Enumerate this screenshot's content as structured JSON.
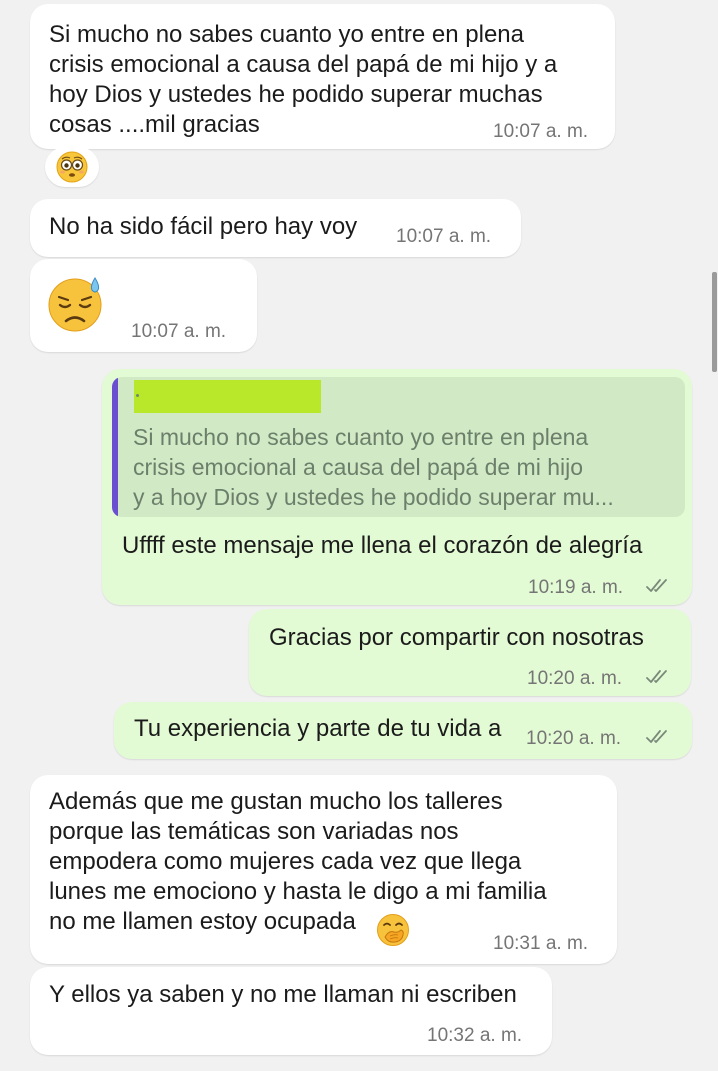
{
  "messages": [
    {
      "direction": "incoming",
      "lines": [
        "Si mucho no sabes cuanto yo entre en plena",
        "crisis emocional a causa del papá de mi hijo y a",
        "hoy Dios y ustedes he podido superar muchas",
        "cosas ....mil gracias"
      ],
      "time": "10:07 a. m."
    },
    {
      "direction": "incoming",
      "reaction_emoji": "flushed-face"
    },
    {
      "direction": "incoming",
      "text": "No ha sido fácil pero hay voy",
      "time": "10:07 a. m."
    },
    {
      "direction": "incoming",
      "emoji": "downcast-face-with-sweat",
      "time": "10:07 a. m."
    },
    {
      "direction": "outgoing",
      "quote": {
        "author": "",
        "lines": [
          "Si mucho no sabes cuanto yo entre en plena",
          "crisis emocional a causa del papá de mi hijo",
          "y a hoy Dios y ustedes he podido superar mu..."
        ]
      },
      "text": "Uffff este mensaje me llena el corazón de alegría",
      "time": "10:19 a. m.",
      "status": "read"
    },
    {
      "direction": "outgoing",
      "text": "Gracias por compartir con nosotras",
      "time": "10:20 a. m.",
      "status": "read"
    },
    {
      "direction": "outgoing",
      "text": "Tu experiencia y parte de tu vida a",
      "time": "10:20 a. m.",
      "status": "read"
    },
    {
      "direction": "incoming",
      "lines": [
        "Además que me gustan mucho los talleres",
        "porque las temáticas son variadas nos",
        "empodera como mujeres cada vez que llega",
        "lunes me emociono y hasta le digo a mi familia",
        "no me llamen estoy ocupada"
      ],
      "emoji": "face-with-hand-over-mouth",
      "time": "10:31 a. m."
    },
    {
      "direction": "incoming",
      "text": "Y ellos ya saben y no me llaman ni escriben",
      "time": "10:32 a. m."
    }
  ],
  "colors": {
    "background": "#f1f1f1",
    "incoming_bubble": "#ffffff",
    "outgoing_bubble": "#e3fbd4",
    "quote_background": "#d2e9c6",
    "quote_bar": "#6a4fd1",
    "author_redaction": "#b9e82a",
    "read_ticks": "#7a8a7a"
  }
}
